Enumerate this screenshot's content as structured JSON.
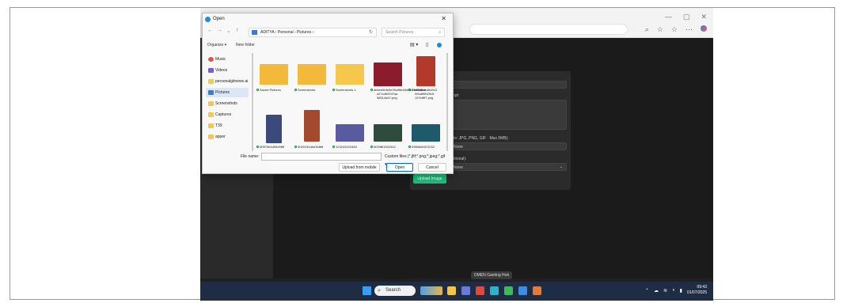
{
  "colors": {
    "accent": "#19c37d",
    "dialog_bg": "#f8f8f8",
    "page_bg": "#1b1b1b",
    "taskbar": "#1f2d44",
    "selection": "#dbe7f6"
  },
  "dialog": {
    "title": "Open",
    "close_icon": "close-icon",
    "breadcrumb": "ADITYA  ›  Personal  ›  Pictures  ›",
    "search_placeholder": "Search Pictures",
    "organize_label": "Organize ▾",
    "new_folder_label": "New folder",
    "sidebar": [
      {
        "label": "Music",
        "icon": "music-icon",
        "color": "#e05353"
      },
      {
        "label": "Videos",
        "icon": "videos-icon",
        "color": "#7b5bd6"
      },
      {
        "label": "personalgitnews.ai",
        "icon": "folder-icon",
        "color": "#f2c94c"
      },
      {
        "label": "Pictures",
        "icon": "pictures-icon",
        "color": "#3a7bd5"
      },
      {
        "label": "Screenshots",
        "icon": "folder-icon",
        "color": "#f2c94c"
      },
      {
        "label": "Captures",
        "icon": "folder-icon",
        "color": "#f2c94c"
      },
      {
        "label": "T39",
        "icon": "folder-icon",
        "color": "#f2c94c"
      },
      {
        "label": "apper",
        "icon": "folder-icon",
        "color": "#f2c94c"
      }
    ],
    "files": [
      {
        "caption": "Saved Pictures",
        "kind": "folder"
      },
      {
        "caption": "Screenshots",
        "kind": "folder"
      },
      {
        "caption": "Screenshots 1",
        "kind": "folder"
      },
      {
        "caption": "dbbed4bfa3e39c6ffe46d04f7aa5d8de",
        "caption2": "a27cd60047aa",
        "caption3": "58014a57.png",
        "kind": "image",
        "color": "#8b1c2b"
      },
      {
        "caption": "d4ff8fd6ded5d9c3",
        "caption2": "0f4a8f0b29c5",
        "caption3": "197e8ff7.png",
        "kind": "image",
        "color": "#b33a2a"
      },
      {
        "caption": "0f9f79b4d59d98ff",
        "kind": "image",
        "color": "#3a4a7a"
      },
      {
        "caption": "0f1f01544be3b8f8",
        "kind": "image",
        "color": "#a34a2e"
      },
      {
        "caption": "123243201548",
        "kind": "image",
        "color": "#5a5aa0"
      },
      {
        "caption": "0f29f8f1532542",
        "kind": "image",
        "color": "#2e4b3e"
      },
      {
        "caption": "09f66b84f72032",
        "kind": "image",
        "color": "#1f5a6a"
      }
    ],
    "filename_label": "File name:",
    "filename_value": "",
    "filetype_label": "Custom files (*.jfif;*.png;*.jpeg;*.gif ▾",
    "upload_mobile_label": "Upload from mobile",
    "open_label": "Open",
    "cancel_label": "Cancel"
  },
  "page": {
    "label_prompt": "rompt:",
    "label_formats": "mats: JPG, PNG, GIF · Max 5MB):",
    "field_file_value": "None",
    "label_optional": "(Optional):",
    "select_value": "None",
    "upload_button": "Upload Image",
    "footer_button": "OMEN Gaming Hub"
  },
  "taskbar": {
    "search_label": "Search",
    "time": "09:43",
    "date": "01/07/2025"
  }
}
